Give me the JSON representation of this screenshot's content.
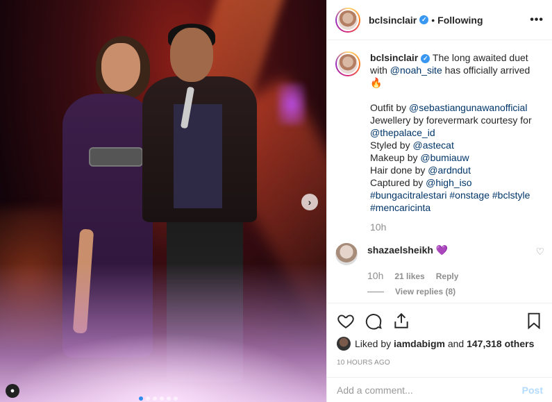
{
  "post": {
    "username": "bclsinclair",
    "following": "Following",
    "more": "•••",
    "carousel_dots": 6,
    "carousel_active": 0
  },
  "caption": {
    "username": "bclsinclair",
    "text_a": "The long awaited duet with",
    "mention_noah": "@noah_site",
    "text_b": "has officially arrived",
    "emoji": "🔥",
    "outfit_label": "Outfit by",
    "outfit_mention": "@sebastiangunawanofficial",
    "jewel_label": "Jewellery by forevermark courtesy for",
    "jewel_mention": "@thepalace_id",
    "styled_label": "Styled by",
    "styled_mention": "@astecat",
    "makeup_label": "Makeup by",
    "makeup_mention": "@bumiauw",
    "hair_label": "Hair done by",
    "hair_mention": "@ardndut",
    "captured_label": "Captured by",
    "captured_mention": "@high_iso",
    "hashtags": "#bungacitralestari #onstage #bclstyle #mencaricinta",
    "time": "10h"
  },
  "comment": {
    "username": "shazaelsheikh",
    "text": "💜",
    "time": "10h",
    "likes": "21 likes",
    "reply": "Reply",
    "view_replies": "View replies (8)"
  },
  "actions": {
    "liked_by_label": "Liked by",
    "liked_by_user": "iamdabigm",
    "and_label": "and",
    "others": "147,318 others",
    "ago": "10 HOURS AGO"
  },
  "add_comment": {
    "placeholder": "Add a comment...",
    "post_label": "Post"
  },
  "colors": {
    "verified": "#3897f0",
    "link": "#003569",
    "muted": "#8e8e8e",
    "post_disabled": "#b3dbff"
  }
}
